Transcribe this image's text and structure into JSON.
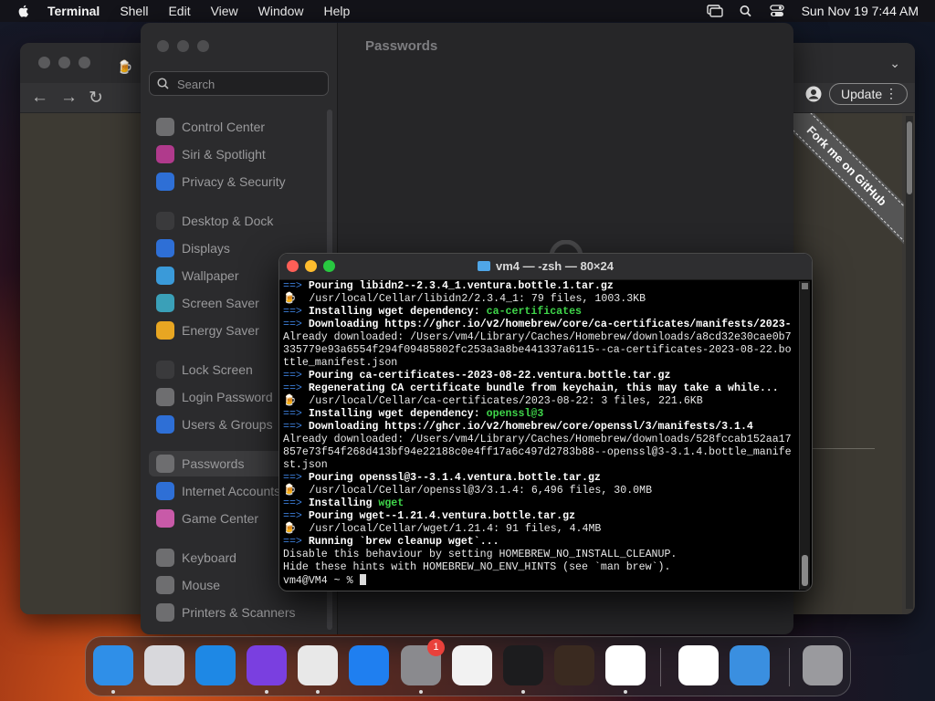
{
  "menubar": {
    "app_name": "Terminal",
    "items": [
      "Shell",
      "Edit",
      "View",
      "Window",
      "Help"
    ],
    "clock": "Sun Nov 19  7:44 AM"
  },
  "browser": {
    "update_label": "Update",
    "ribbon_text": "Fork me on GitHub"
  },
  "settings": {
    "title": "Passwords",
    "search_placeholder": "Search",
    "sidebar": [
      {
        "label": "Control Center",
        "icon": "control-center-icon",
        "color": "#6e6e70"
      },
      {
        "label": "Siri & Spotlight",
        "icon": "siri-icon",
        "color": "#b03a8c"
      },
      {
        "label": "Privacy & Security",
        "icon": "privacy-hand-icon",
        "color": "#2e6fd6"
      },
      {
        "label": "Desktop & Dock",
        "icon": "desktop-dock-icon",
        "color": "#3a3a3c"
      },
      {
        "label": "Displays",
        "icon": "displays-icon",
        "color": "#2e6fd6"
      },
      {
        "label": "Wallpaper",
        "icon": "wallpaper-icon",
        "color": "#3a9ad9"
      },
      {
        "label": "Screen Saver",
        "icon": "screen-saver-icon",
        "color": "#3aa0b8"
      },
      {
        "label": "Energy Saver",
        "icon": "energy-saver-icon",
        "color": "#e8a622"
      },
      {
        "label": "Lock Screen",
        "icon": "lock-icon",
        "color": "#3a3a3c"
      },
      {
        "label": "Login Password",
        "icon": "login-password-icon",
        "color": "#6e6e70"
      },
      {
        "label": "Users & Groups",
        "icon": "users-groups-icon",
        "color": "#2e6fd6"
      },
      {
        "label": "Passwords",
        "icon": "key-icon",
        "color": "#6e6e70"
      },
      {
        "label": "Internet Accounts",
        "icon": "at-icon",
        "color": "#2e6fd6"
      },
      {
        "label": "Game Center",
        "icon": "game-center-icon",
        "color": "#c85aa8"
      },
      {
        "label": "Keyboard",
        "icon": "keyboard-icon",
        "color": "#6e6e70"
      },
      {
        "label": "Mouse",
        "icon": "mouse-icon",
        "color": "#6e6e70"
      },
      {
        "label": "Printers & Scanners",
        "icon": "printer-icon",
        "color": "#6e6e70"
      }
    ],
    "selected": "Passwords"
  },
  "terminal": {
    "title": "vm4 — -zsh — 80×24",
    "lines": [
      [
        [
          "arrow",
          "==> "
        ],
        [
          "bold",
          "Pouring libidn2--2.3.4_1.ventura.bottle.1.tar.gz"
        ]
      ],
      [
        [
          "plain",
          "🍺  /usr/local/Cellar/libidn2/2.3.4_1: 79 files, 1003.3KB"
        ]
      ],
      [
        [
          "arrow",
          "==> "
        ],
        [
          "bold",
          "Installing wget dependency: "
        ],
        [
          "green",
          "ca-certificates"
        ]
      ],
      [
        [
          "arrow",
          "==> "
        ],
        [
          "bold",
          "Downloading https://ghcr.io/v2/homebrew/core/ca-certificates/manifests/2023-"
        ]
      ],
      [
        [
          "plain",
          "Already downloaded: /Users/vm4/Library/Caches/Homebrew/downloads/a8cd32e30cae0b7"
        ]
      ],
      [
        [
          "plain",
          "335779e93a6554f294f09485802fc253a3a8be441337a6115--ca-certificates-2023-08-22.bo"
        ]
      ],
      [
        [
          "plain",
          "ttle_manifest.json"
        ]
      ],
      [
        [
          "arrow",
          "==> "
        ],
        [
          "bold",
          "Pouring ca-certificates--2023-08-22.ventura.bottle.tar.gz"
        ]
      ],
      [
        [
          "arrow",
          "==> "
        ],
        [
          "bold",
          "Regenerating CA certificate bundle from keychain, this may take a while..."
        ]
      ],
      [
        [
          "plain",
          "🍺  /usr/local/Cellar/ca-certificates/2023-08-22: 3 files, 221.6KB"
        ]
      ],
      [
        [
          "arrow",
          "==> "
        ],
        [
          "bold",
          "Installing wget dependency: "
        ],
        [
          "green",
          "openssl@3"
        ]
      ],
      [
        [
          "arrow",
          "==> "
        ],
        [
          "bold",
          "Downloading https://ghcr.io/v2/homebrew/core/openssl/3/manifests/3.1.4"
        ]
      ],
      [
        [
          "plain",
          "Already downloaded: /Users/vm4/Library/Caches/Homebrew/downloads/528fccab152aa17"
        ]
      ],
      [
        [
          "plain",
          "857e73f54f268d413bf94e22188c0e4ff17a6c497d2783b88--openssl@3-3.1.4.bottle_manife"
        ]
      ],
      [
        [
          "plain",
          "st.json"
        ]
      ],
      [
        [
          "arrow",
          "==> "
        ],
        [
          "bold",
          "Pouring openssl@3--3.1.4.ventura.bottle.tar.gz"
        ]
      ],
      [
        [
          "plain",
          "🍺  /usr/local/Cellar/openssl@3/3.1.4: 6,496 files, 30.0MB"
        ]
      ],
      [
        [
          "arrow",
          "==> "
        ],
        [
          "bold",
          "Installing "
        ],
        [
          "green",
          "wget"
        ]
      ],
      [
        [
          "arrow",
          "==> "
        ],
        [
          "bold",
          "Pouring wget--1.21.4.ventura.bottle.tar.gz"
        ]
      ],
      [
        [
          "plain",
          "🍺  /usr/local/Cellar/wget/1.21.4: 91 files, 4.4MB"
        ]
      ],
      [
        [
          "arrow",
          "==> "
        ],
        [
          "bold",
          "Running `brew cleanup wget`..."
        ]
      ],
      [
        [
          "plain",
          "Disable this behaviour by setting HOMEBREW_NO_INSTALL_CLEANUP."
        ]
      ],
      [
        [
          "plain",
          "Hide these hints with HOMEBREW_NO_ENV_HINTS (see `man brew`)."
        ]
      ],
      [
        [
          "plain",
          "vm4@VM4 ~ % "
        ],
        [
          "cursor",
          ""
        ]
      ]
    ]
  },
  "dock": {
    "apps": [
      {
        "name": "finder-icon",
        "color": "#2f8fe8",
        "running": true
      },
      {
        "name": "launchpad-icon",
        "color": "#d8d8dc",
        "running": false
      },
      {
        "name": "safari-icon",
        "color": "#1e88e5",
        "running": false
      },
      {
        "name": "firefox-icon",
        "color": "#7a3fe0",
        "running": true
      },
      {
        "name": "chrome-icon",
        "color": "#e8e8e8",
        "running": true
      },
      {
        "name": "app-store-icon",
        "color": "#1f7ff0",
        "running": false
      },
      {
        "name": "system-settings-icon",
        "color": "#8a8a8e",
        "running": true
      },
      {
        "name": "textedit-icon",
        "color": "#f2f2f2",
        "running": false
      },
      {
        "name": "terminal-icon",
        "color": "#1c1c1e",
        "running": true
      },
      {
        "name": "garageband-icon",
        "color": "#3a2a20",
        "running": false
      },
      {
        "name": "vscode-icon",
        "color": "#ffffff",
        "running": true
      },
      {
        "name": "visual-studio-icon",
        "color": "#ffffff",
        "running": false
      },
      {
        "name": "weather-icon",
        "color": "#3a8fe0",
        "running": false
      },
      {
        "name": "trash-icon",
        "color": "#9a9a9e",
        "running": false
      }
    ],
    "settings_badge": "1"
  }
}
